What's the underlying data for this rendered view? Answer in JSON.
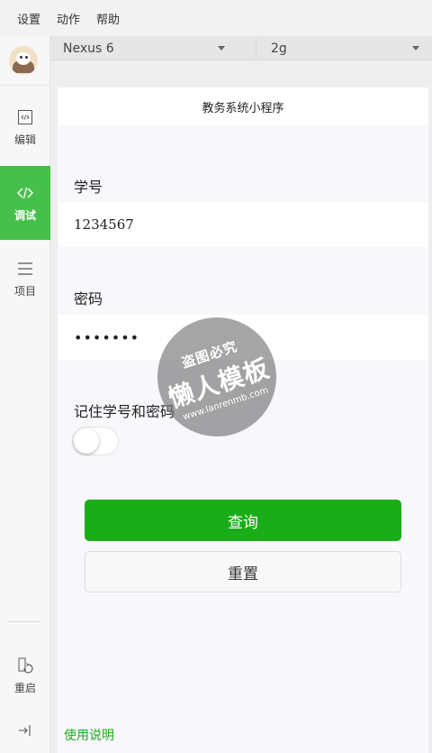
{
  "menu": {
    "items": [
      "设置",
      "动作",
      "帮助"
    ]
  },
  "sidebar": {
    "items": [
      {
        "id": "edit",
        "label": "编辑",
        "active": false
      },
      {
        "id": "debug",
        "label": "调试",
        "active": true
      },
      {
        "id": "project",
        "label": "项目",
        "active": false
      },
      {
        "id": "restart",
        "label": "重启",
        "active": false
      }
    ]
  },
  "device_bar": {
    "device": "Nexus 6",
    "network": "2g"
  },
  "simulator": {
    "title": "教务系统小程序",
    "student_id_label": "学号",
    "student_id_value": "1234567",
    "password_label": "密码",
    "password_value": "•••••••",
    "remember_label": "记住学号和密码",
    "remember_on": false,
    "query_button": "查询",
    "reset_button": "重置",
    "help_link": "使用说明"
  },
  "watermark": {
    "line1": "盗图必究",
    "line2": "懒人模板",
    "line3": "www.lanrenmb.com"
  },
  "colors": {
    "accent": "#46c04b",
    "primary_button": "#1aad19",
    "link": "#1aad19"
  }
}
